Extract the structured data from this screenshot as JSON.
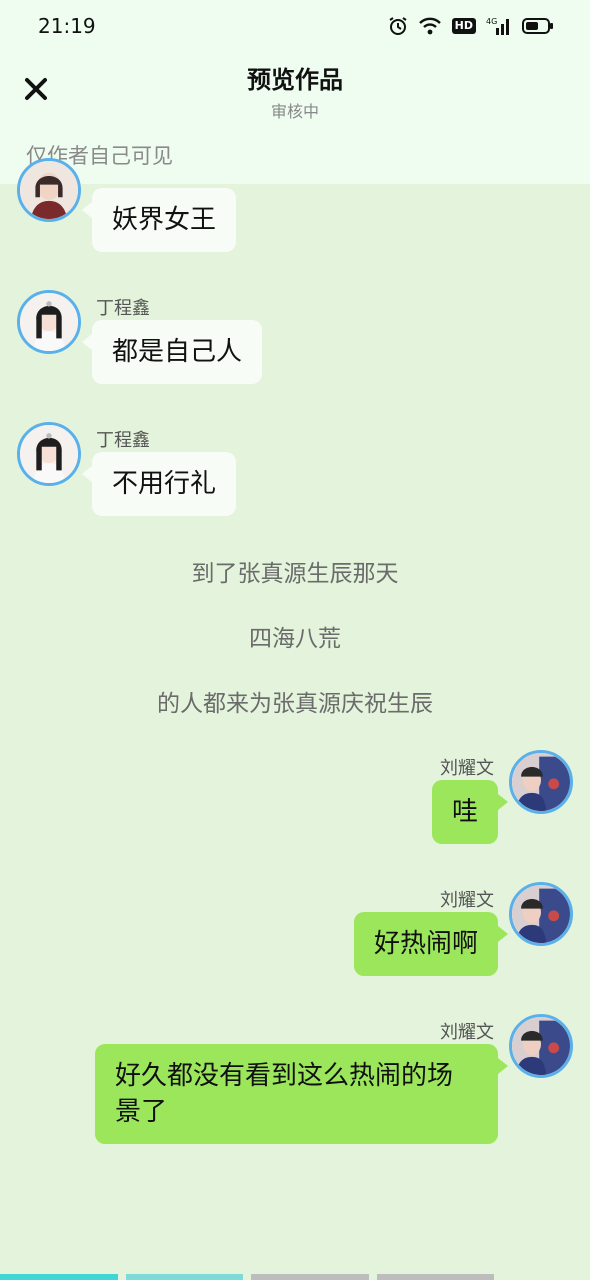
{
  "status_bar": {
    "time": "21:19",
    "hd_label": "HD",
    "network_label": "4G"
  },
  "header": {
    "title": "预览作品",
    "subtitle": "审核中",
    "visibility_note": "仅作者自己可见"
  },
  "messages": [
    {
      "side": "left",
      "name": "",
      "text": "妖界女王"
    },
    {
      "side": "left",
      "name": "丁程鑫",
      "text": "都是自己人"
    },
    {
      "side": "left",
      "name": "丁程鑫",
      "text": "不用行礼"
    }
  ],
  "narration": [
    "到了张真源生辰那天",
    "四海八荒",
    "的人都来为张真源庆祝生辰"
  ],
  "right_messages": [
    {
      "name": "刘耀文",
      "text": "哇"
    },
    {
      "name": "刘耀文",
      "text": "好热闹啊"
    },
    {
      "name": "刘耀文",
      "text": "好久都没有看到这么热闹的场景了"
    }
  ],
  "colors": {
    "accent_bubble": "#9be65a",
    "avatar_ring": "#5ab0ea",
    "background": "#e4f4dc"
  },
  "progress": {
    "segments": 4,
    "active_segment": 1
  }
}
